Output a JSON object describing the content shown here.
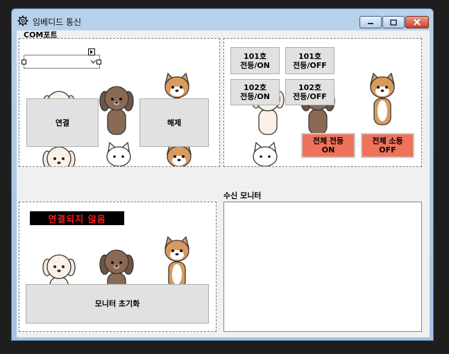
{
  "window": {
    "title": "임베디드 통신",
    "icons": {
      "app": "gear-icon",
      "minimize": "minimize-icon",
      "maximize": "maximize-icon",
      "close": "close-icon"
    }
  },
  "com_group": {
    "label": "COM포트",
    "combo_value": "",
    "connect_label": "연결",
    "disconnect_label": "해제"
  },
  "control_group": {
    "room101_on": "101호\n전등/ON",
    "room101_off": "101호\n전등/OFF",
    "room102_on": "102호\n전등/ON",
    "room102_off": "102호\n전등/OFF",
    "all_on": "전체 전등\nON",
    "all_off": "전체 소등\nOFF"
  },
  "status_group": {
    "status_text": "연결되지 않음",
    "reset_label": "모니터 초기화"
  },
  "monitor": {
    "label": "수신 모니터",
    "content": ""
  },
  "colors": {
    "status_bg": "#000000",
    "status_text": "#ff1a1a",
    "all_button": "#f0725a"
  }
}
